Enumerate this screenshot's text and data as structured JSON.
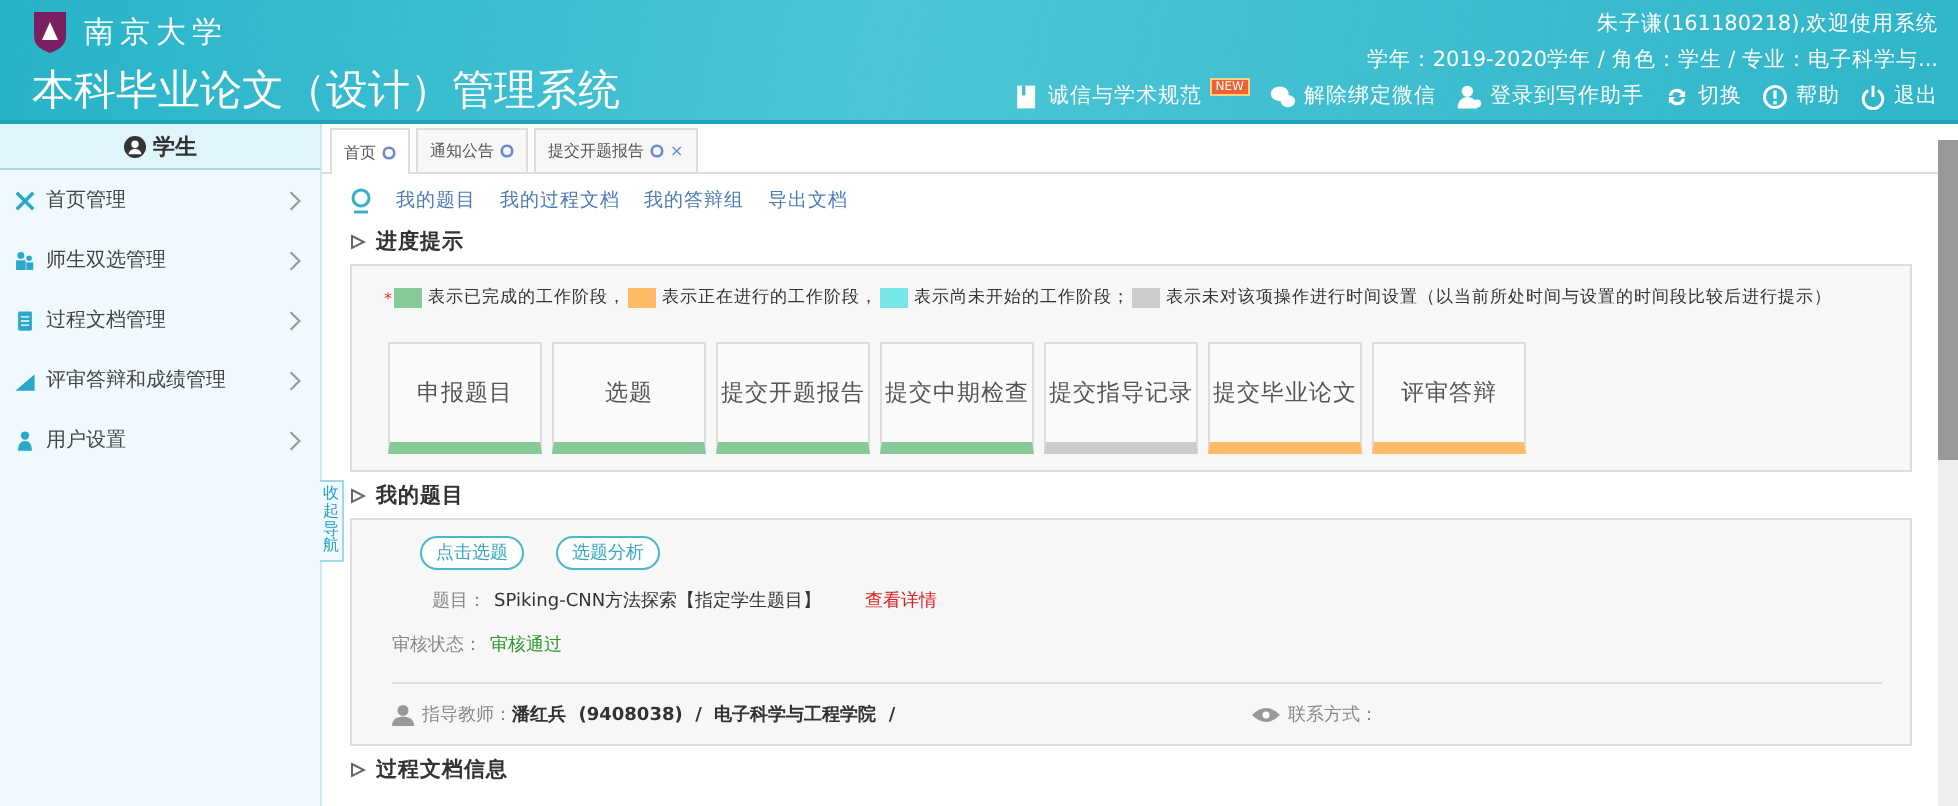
{
  "header": {
    "school": "南京大学",
    "system_title": "本科毕业论文（设计）管理系统",
    "welcome": "朱子谦(161180218),欢迎使用系统",
    "info": "学年：2019-2020学年 / 角色：学生 / 专业：电子科学与...",
    "toolbar": [
      {
        "kind": "book",
        "label": "诚信与学术规范",
        "badge": "NEW"
      },
      {
        "kind": "wechat",
        "label": "解除绑定微信"
      },
      {
        "kind": "user",
        "label": "登录到写作助手"
      },
      {
        "kind": "switch",
        "label": "切换"
      },
      {
        "kind": "help",
        "label": "帮助"
      },
      {
        "kind": "power",
        "label": "退出"
      }
    ]
  },
  "sidebar": {
    "title": "学生",
    "collapse_label": "收起导航",
    "items": [
      {
        "kind": "tools",
        "label": "首页管理"
      },
      {
        "kind": "people",
        "label": "师生双选管理"
      },
      {
        "kind": "doc",
        "label": "过程文档管理"
      },
      {
        "kind": "chart",
        "label": "评审答辩和成绩管理"
      },
      {
        "kind": "user",
        "label": "用户设置"
      }
    ]
  },
  "tabs": [
    {
      "label": "首页",
      "selected": true
    },
    {
      "label": "通知公告",
      "selected": false
    },
    {
      "label": "提交开题报告",
      "selected": false,
      "close": "×"
    }
  ],
  "links": [
    "我的题目",
    "我的过程文档",
    "我的答辩组",
    "导出文档"
  ],
  "progress": {
    "heading": "进度提示",
    "marker": "*",
    "legend": [
      {
        "color": "#88c999",
        "text": "表示已完成的工作阶段，"
      },
      {
        "color": "#ffbb66",
        "text": "表示正在进行的工作阶段，"
      },
      {
        "color": "#77e6e6",
        "text": "表示尚未开始的工作阶段；"
      },
      {
        "color": "#cccccc",
        "text": "表示未对该项操作进行时间设置（以当前所处时间与设置的时间段比较后进行提示）"
      }
    ],
    "stages": [
      {
        "label": "申报题目",
        "color": "#88c999"
      },
      {
        "label": "选题",
        "color": "#88c999"
      },
      {
        "label": "提交开题报告",
        "color": "#88c999"
      },
      {
        "label": "提交中期检查",
        "color": "#88c999"
      },
      {
        "label": "提交指导记录",
        "color": "#cccccc"
      },
      {
        "label": "提交毕业论文",
        "color": "#ffbb66"
      },
      {
        "label": "评审答辩",
        "color": "#ffbb66"
      }
    ]
  },
  "topic": {
    "heading": "我的题目",
    "buttons": [
      "点击选题",
      "选题分析"
    ],
    "title_label": "题目：",
    "title_value": "SPiking-CNN方法探索【指定学生题目】",
    "detail_link": "查看详情",
    "status_label": "审核状态：",
    "status_value": "审核通过",
    "advisor_label": "指导教师：",
    "advisor_value": "潘红兵  (9408038)  /  电子科学与工程学院  /",
    "contact_label": "联系方式："
  },
  "next_heading": "过程文档信息"
}
